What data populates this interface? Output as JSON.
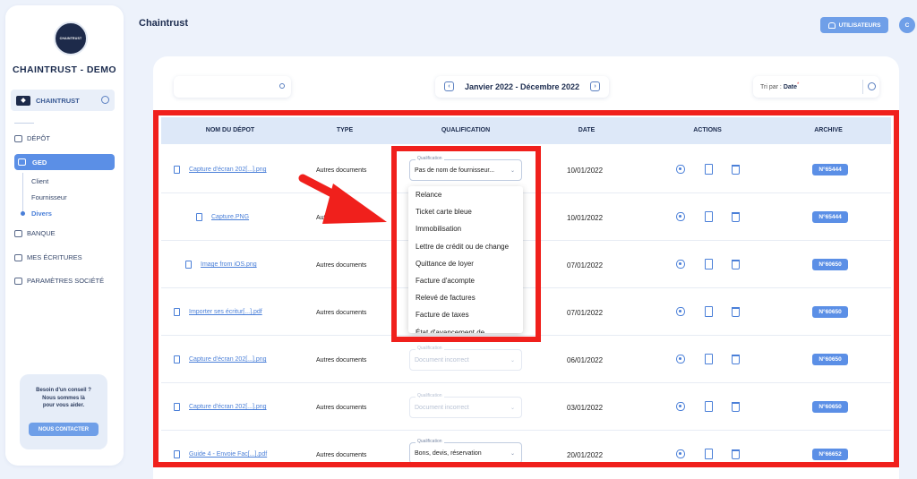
{
  "sidebar": {
    "logo_text": "CHAINTRUST",
    "company_name": "CHAINTRUST - DEMO",
    "company_selector": "CHAINTRUST",
    "nav": [
      {
        "label": "DÉPÔT",
        "icon": "folder-icon"
      },
      {
        "label": "GED",
        "icon": "folder-open-icon",
        "active": true
      },
      {
        "label": "BANQUE",
        "icon": "bank-icon"
      },
      {
        "label": "MES ÉCRITURES",
        "icon": "folder-icon"
      },
      {
        "label": "PARAMÈTRES SOCIÉTÉ",
        "icon": "sliders-icon"
      }
    ],
    "ged_sub": [
      "Client",
      "Fournisseur",
      "Divers"
    ],
    "help": {
      "line1": "Besoin d'un conseil ?",
      "line2": "Nous sommes là",
      "line3": "pour vous aider.",
      "button": "NOUS CONTACTER"
    }
  },
  "header": {
    "title": "Chaintrust",
    "users_button": "UTILISATEURS",
    "avatar_initial": "C"
  },
  "toolbar": {
    "search_placeholder": "",
    "date_range": "Janvier 2022 - Décembre 2022",
    "sort_label": "Tri par :",
    "sort_value": "Date",
    "sort_marker": "*"
  },
  "table": {
    "columns": [
      "NOM DU DÉPOT",
      "TYPE",
      "QUALIFICATION",
      "DATE",
      "ACTIONS",
      "ARCHIVE"
    ],
    "rows": [
      {
        "name": "Capture d'écran 202[...].png",
        "type": "Autres documents",
        "qual_label": "Qualification",
        "qualification": "Pas de nom de fournisseur...",
        "date": "10/01/2022",
        "archive": "N°65444"
      },
      {
        "name": "Capture.PNG",
        "type": "Autres documents",
        "qual_label": "",
        "qualification": "",
        "date": "10/01/2022",
        "archive": "N°65444"
      },
      {
        "name": "Image from iOS.png",
        "type": "Autres documents",
        "qual_label": "",
        "qualification": "",
        "date": "07/01/2022",
        "archive": "N°60650"
      },
      {
        "name": "Importer ses écritur[...].pdf",
        "type": "Autres documents",
        "qual_label": "",
        "qualification": "",
        "date": "07/01/2022",
        "archive": "N°60650"
      },
      {
        "name": "Capture d'écran 202[...].png",
        "type": "Autres documents",
        "qual_label": "Qualification",
        "qualification": "Document incorrect",
        "date": "06/01/2022",
        "archive": "N°60650"
      },
      {
        "name": "Capture d'écran 202[...].png",
        "type": "Autres documents",
        "qual_label": "Qualification",
        "qualification": "Document incorrect",
        "date": "03/01/2022",
        "archive": "N°60650"
      },
      {
        "name": "Guide 4 - Envoie Fac[...].pdf",
        "type": "Autres documents",
        "qual_label": "Qualification",
        "qualification": "Bons, devis, réservation",
        "date": "20/01/2022",
        "archive": "N°66652"
      }
    ]
  },
  "dropdown": {
    "options": [
      "Relance",
      "Ticket carte bleue",
      "Immobilisation",
      "Lettre de crédit ou de change",
      "Quittance de loyer",
      "Facture d'acompte",
      "Relevé de factures",
      "Facture de taxes",
      "État d'avancement de"
    ]
  },
  "colors": {
    "accent": "#5b8fe6",
    "annotation": "#f0201c",
    "navy": "#1b2b4e"
  }
}
